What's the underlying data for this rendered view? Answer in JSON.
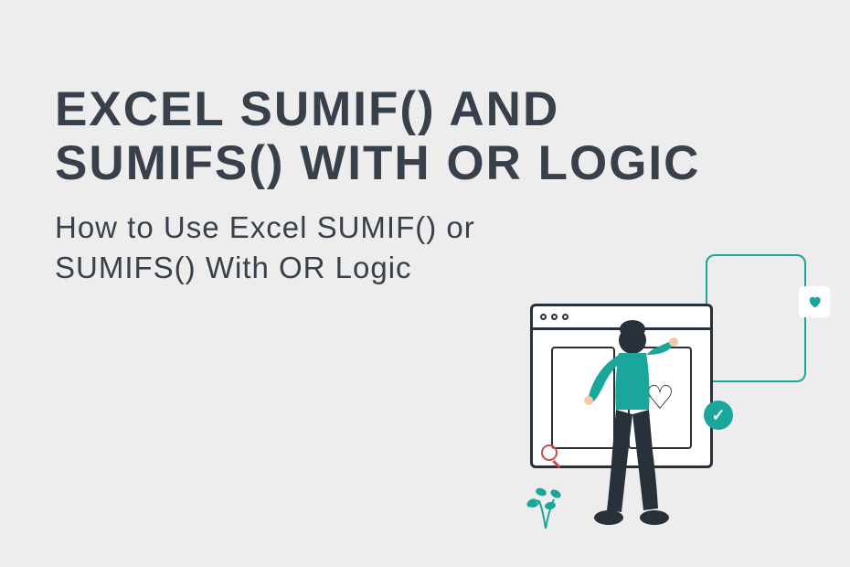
{
  "title": "EXCEL SUMIF() AND SUMIFS() WITH OR LOGIC",
  "subtitle": "How to Use Excel SUMIF() or SUMIFS() With OR Logic",
  "colors": {
    "background": "#EDEDED",
    "text_primary": "#38404B",
    "accent_teal": "#1BA69C",
    "accent_red": "#C94B4B"
  }
}
